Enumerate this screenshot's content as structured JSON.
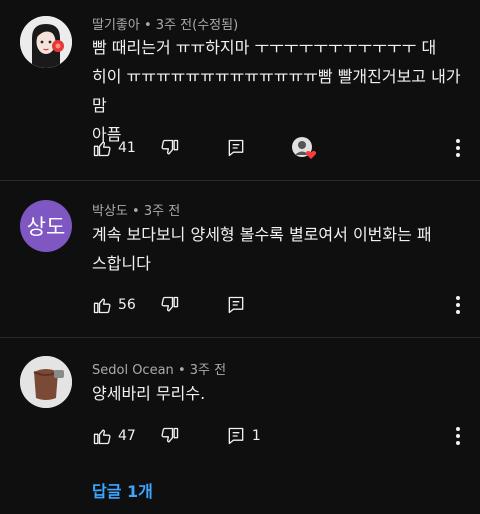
{
  "comments": [
    {
      "author": "딸기좋아",
      "time": "3주 전(수정됨)",
      "lines": [
        "빰 때리는거 ㅠㅠ하지마 ㅜㅜㅜㅜㅜㅜㅜㅜㅜㅜㅜ 대",
        "히이 ㅠㅠㅠㅠㅠㅠㅠㅠㅠㅠㅠㅠㅠ빰 빨개진거보고 내가 맘",
        "아픔"
      ],
      "likes": "41",
      "creator_heart": true
    },
    {
      "author": "박상도",
      "avatar_text": "상도",
      "avatar_color": "#7e57c2",
      "time": "3주 전",
      "lines": [
        "계속 보다보니 양세형 볼수록 별로여서 이번화는 패",
        "스합니다"
      ],
      "likes": "56"
    },
    {
      "author": "Sedol Ocean",
      "time": "3주 전",
      "lines": [
        "양세바리 무리수."
      ],
      "likes": "47",
      "reply_count": "1"
    }
  ],
  "replies_link": "답글 1개",
  "colors": {
    "background": "#0f0f0f",
    "link": "#3ea6ff",
    "heart": "#ff3b3b",
    "meta": "#aaaaaa"
  },
  "icons": [
    "like-icon",
    "dislike-icon",
    "reply-icon",
    "more-vert-icon",
    "creator-heart-icon"
  ]
}
